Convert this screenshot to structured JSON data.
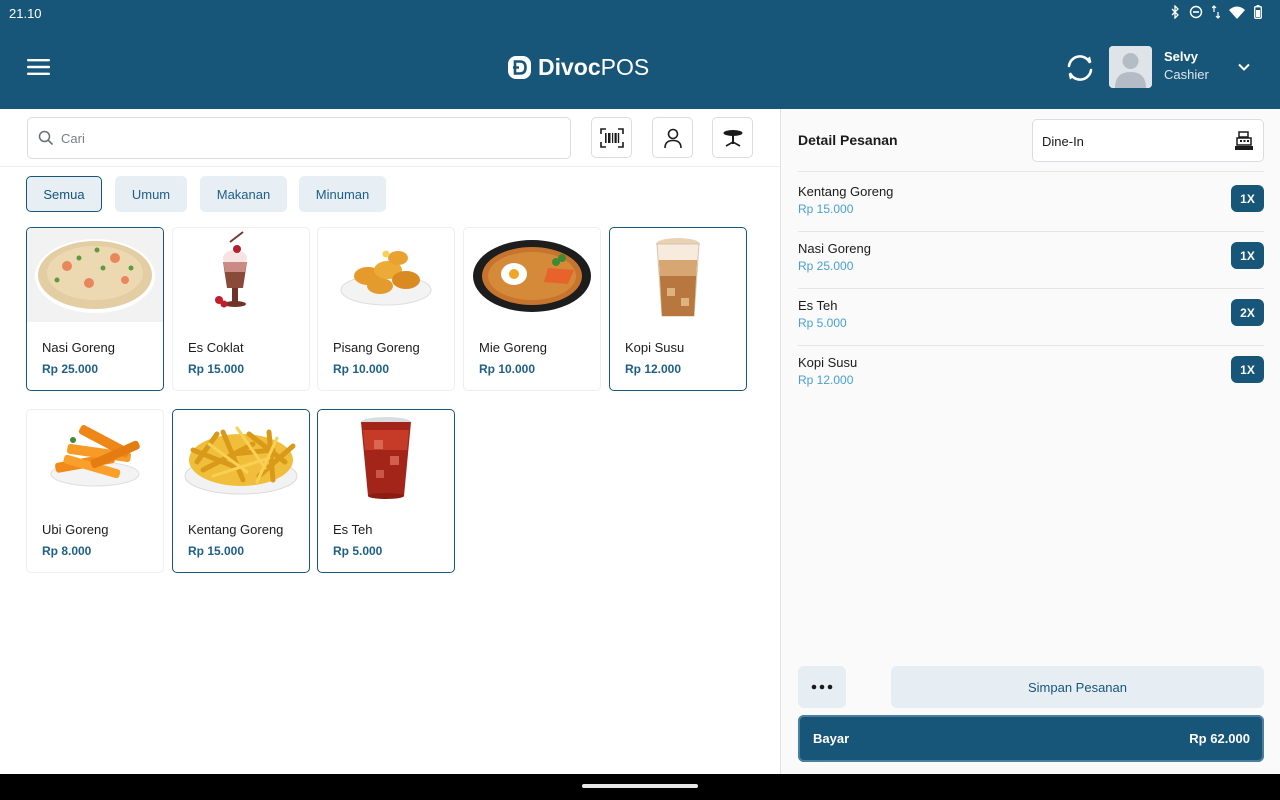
{
  "status_bar": {
    "time": "21.10"
  },
  "header": {
    "brand_strong": "Divoc",
    "brand_light": "POS",
    "user": {
      "name": "Selvy",
      "role": "Cashier"
    }
  },
  "search": {
    "placeholder": "Cari",
    "value": ""
  },
  "categories": [
    {
      "label": "Semua",
      "active": true
    },
    {
      "label": "Umum",
      "active": false
    },
    {
      "label": "Makanan",
      "active": false
    },
    {
      "label": "Minuman",
      "active": false
    }
  ],
  "products": [
    {
      "name": "Nasi Goreng",
      "price": "Rp 25.000",
      "selected": true,
      "image": "fried-rice"
    },
    {
      "name": "Es Coklat",
      "price": "Rp 15.000",
      "selected": false,
      "image": "chocolate-drink"
    },
    {
      "name": "Pisang Goreng",
      "price": "Rp 10.000",
      "selected": false,
      "image": "fried-banana"
    },
    {
      "name": "Mie Goreng",
      "price": "Rp 10.000",
      "selected": false,
      "image": "fried-noodles"
    },
    {
      "name": "Kopi Susu",
      "price": "Rp 12.000",
      "selected": true,
      "image": "iced-coffee"
    },
    {
      "name": "Ubi Goreng",
      "price": "Rp 8.000",
      "selected": false,
      "image": "fried-sweet-potato"
    },
    {
      "name": "Kentang Goreng",
      "price": "Rp 15.000",
      "selected": true,
      "image": "french-fries"
    },
    {
      "name": "Es Teh",
      "price": "Rp 5.000",
      "selected": true,
      "image": "iced-tea"
    }
  ],
  "order": {
    "title": "Detail Pesanan",
    "dine_option": "Dine-In",
    "items": [
      {
        "name": "Kentang Goreng",
        "price": "Rp 15.000",
        "qty": "1X"
      },
      {
        "name": "Nasi Goreng",
        "price": "Rp 25.000",
        "qty": "1X"
      },
      {
        "name": "Es Teh",
        "price": "Rp 5.000",
        "qty": "2X"
      },
      {
        "name": "Kopi Susu",
        "price": "Rp 12.000",
        "qty": "1X"
      }
    ],
    "save_label": "Simpan Pesanan",
    "pay_label": "Bayar",
    "total": "Rp 62.000"
  },
  "colors": {
    "primary": "#175678",
    "accent_price": "#4aa0d1",
    "tab_bg": "#e7eef4"
  }
}
